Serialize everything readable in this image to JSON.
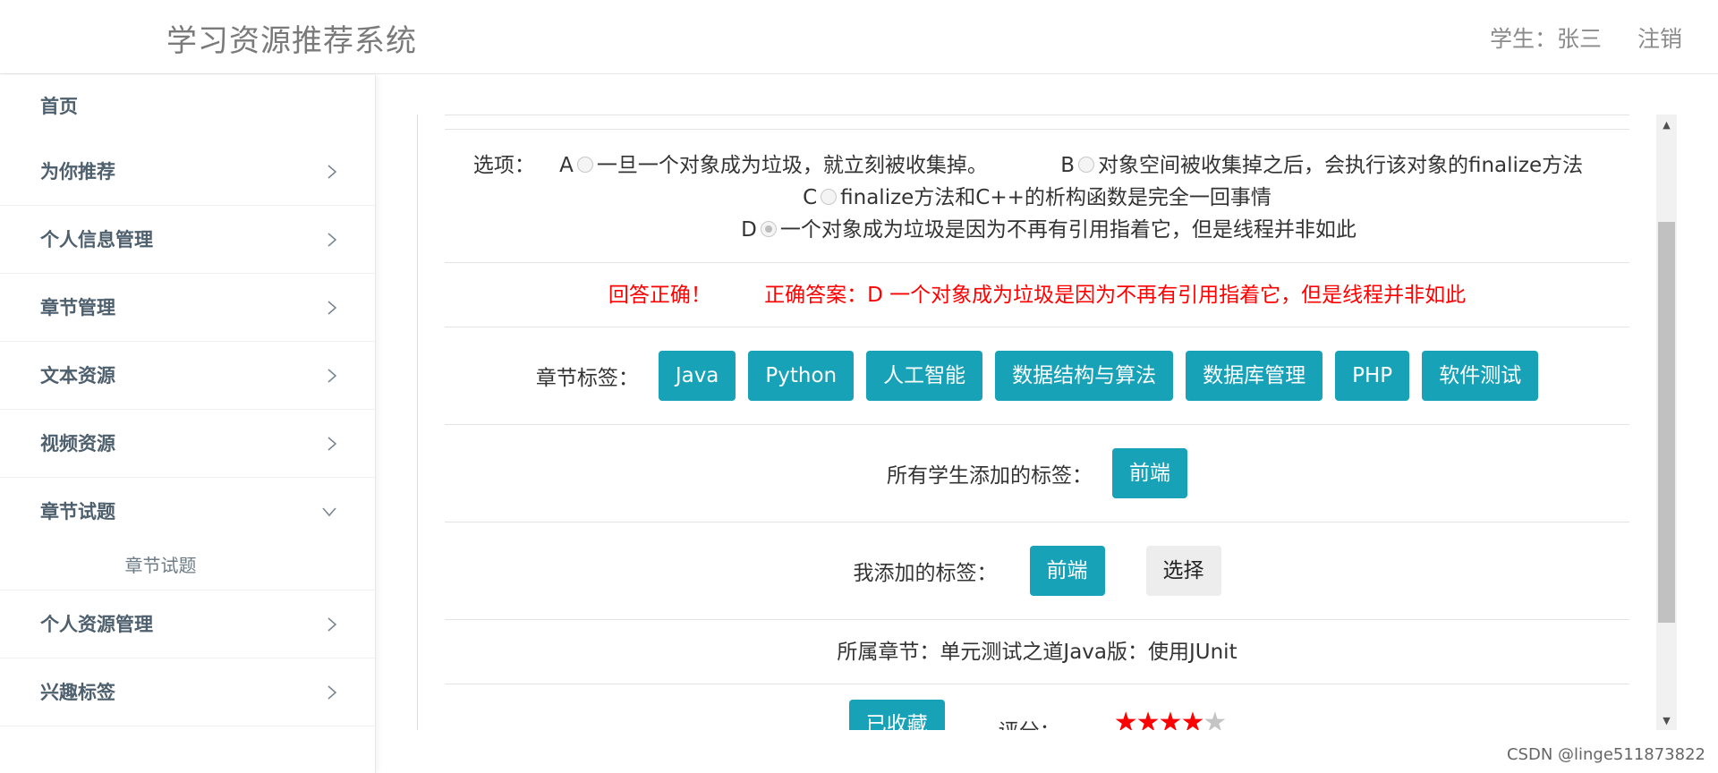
{
  "header": {
    "app_title": "学习资源推荐系统",
    "user_label": "学生：",
    "user_name": "张三",
    "logout": "注销"
  },
  "sidebar": {
    "home": "首页",
    "items": [
      {
        "label": "为你推荐"
      },
      {
        "label": "个人信息管理"
      },
      {
        "label": "章节管理"
      },
      {
        "label": "文本资源"
      },
      {
        "label": "视频资源"
      },
      {
        "label": "章节试题",
        "sub": "章节试题"
      },
      {
        "label": "个人资源管理"
      },
      {
        "label": "兴趣标签"
      }
    ]
  },
  "question": {
    "options_label": "选项：",
    "options": [
      {
        "key": "A",
        "text": "一旦一个对象成为垃圾，就立刻被收集掉。",
        "checked": false
      },
      {
        "key": "B",
        "text": "对象空间被收集掉之后，会执行该对象的finalize方法",
        "checked": false
      },
      {
        "key": "C",
        "text": "finalize方法和C++的析构函数是完全一回事情",
        "checked": false
      },
      {
        "key": "D",
        "text": "一个对象成为垃圾是因为不再有引用指着它，但是线程并非如此",
        "checked": true
      }
    ],
    "result": "回答正确！",
    "correct_answer": "正确答案：D 一个对象成为垃圾是因为不再有引用指着它，但是线程并非如此"
  },
  "tags": {
    "chapter_tags_label": "章节标签：",
    "chapter_tags": [
      "Java",
      "Python",
      "人工智能",
      "数据结构与算法",
      "数据库管理",
      "PHP",
      "软件测试"
    ],
    "all_students_label": "所有学生添加的标签：",
    "all_students_tags": [
      "前端"
    ],
    "my_tags_label": "我添加的标签：",
    "my_tags": [
      "前端"
    ],
    "select_button": "选择"
  },
  "chapter": {
    "text": "所属章节：单元测试之道Java版：使用JUnit"
  },
  "bottom": {
    "favorite_button": "已收藏",
    "rating_label": "评分：",
    "rating": 4,
    "rating_max": 5
  },
  "colors": {
    "accent": "#17a2b8",
    "error_text": "#ff0000",
    "star_on": "#ff0000",
    "star_off": "#c4c4c4"
  },
  "watermark": "CSDN @linge511873822"
}
